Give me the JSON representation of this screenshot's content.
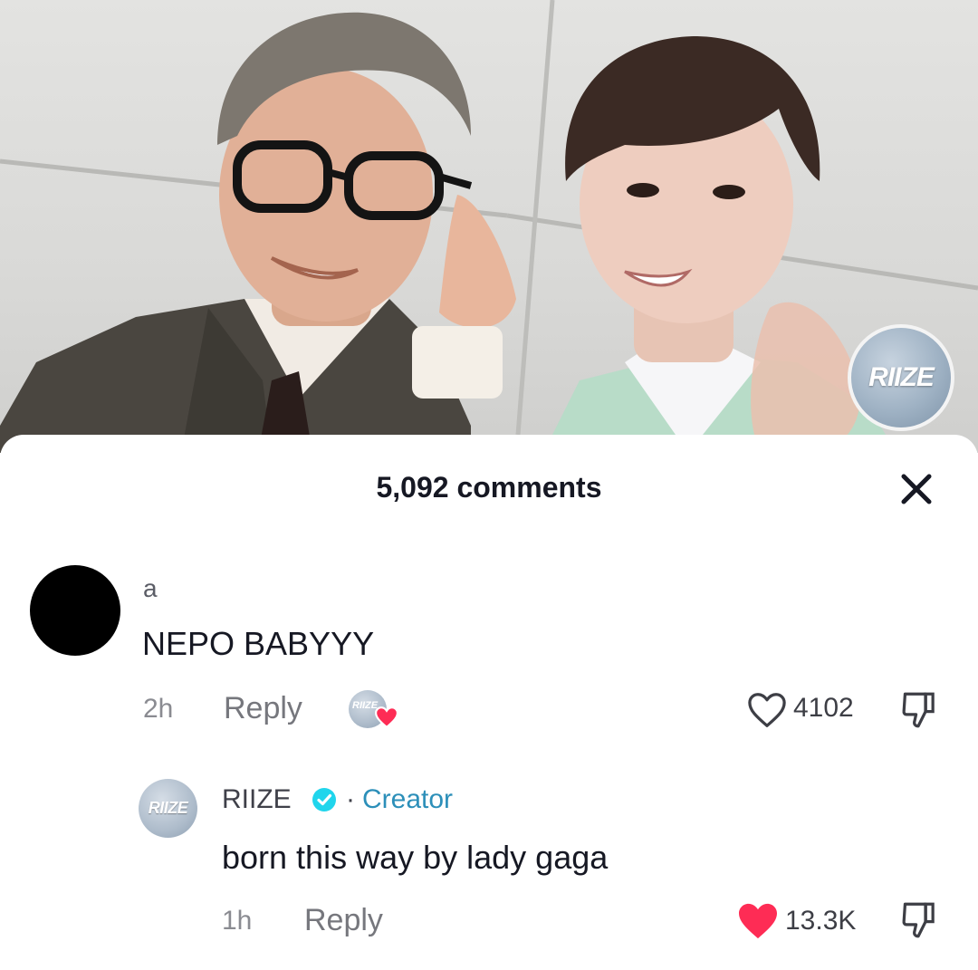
{
  "video": {
    "watermark_text": "RIIZE"
  },
  "sheet": {
    "title": "5,092 comments"
  },
  "comments": [
    {
      "username": "a",
      "text": "NEPO BABYYY",
      "time": "2h",
      "reply_label": "Reply",
      "likes": "4102",
      "liked_by_creator": true,
      "creator_badge_text": "RIIZE"
    },
    {
      "username": "RIIZE",
      "avatar_text": "RIIZE",
      "verified": true,
      "separator": "·",
      "tag": "Creator",
      "text": "born this way by lady gaga",
      "time": "1h",
      "reply_label": "Reply",
      "likes": "13.3K",
      "liked": true
    }
  ],
  "colors": {
    "like_active": "#fe2c55",
    "verified_badge": "#20d5ec",
    "creator_tag": "#2c8fb9",
    "text_primary": "#161823",
    "text_secondary": "#8a8b91"
  }
}
